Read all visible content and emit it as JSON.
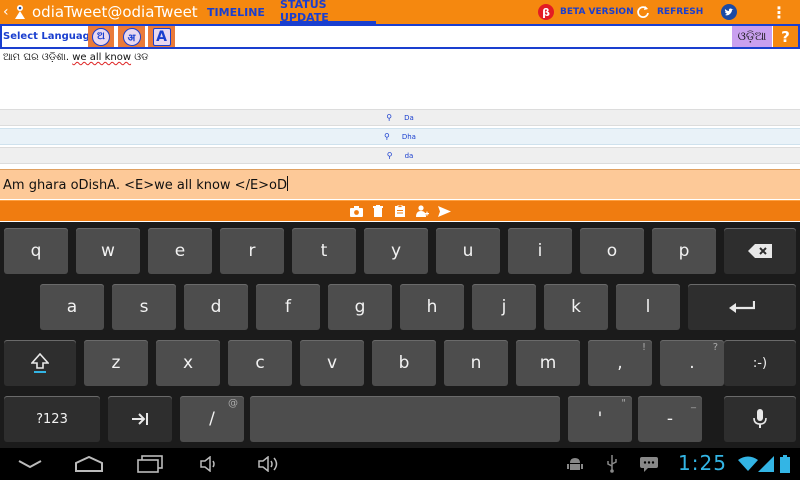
{
  "actionbar": {
    "title": "odiaTweet@odiaTweet",
    "tabs": [
      {
        "label": "TIMELINE",
        "selected": false
      },
      {
        "label": "STATUS UPDATE",
        "selected": true
      }
    ],
    "beta_icon": "β",
    "beta_label": "BETA VERSION",
    "refresh_label": "REFRESH",
    "accent": "#f5880f",
    "tab_color": "#1a3fcf"
  },
  "language": {
    "label": "Select Language",
    "buttons": [
      "ଅ",
      "अ",
      "A"
    ],
    "script_label": "ଓଡ଼ିଆ",
    "help_label": "?"
  },
  "preview": {
    "odia": "ଆମ ଘର ଓଡ଼ିଶା.",
    "english": "we all know",
    "tail": "ଓଡ"
  },
  "suggestions": [
    {
      "text": "Da",
      "highlight": false
    },
    {
      "text": "Dha",
      "highlight": true
    },
    {
      "text": "da",
      "highlight": false
    }
  ],
  "input": {
    "value": "Am ghara oDishA. <E>we all know </E>oD",
    "background": "#fdc998"
  },
  "toolbar": {
    "icons": [
      "camera-icon",
      "trash-icon",
      "clipboard-icon",
      "add-user-icon",
      "send-icon"
    ]
  },
  "keyboard": {
    "row1": [
      "q",
      "w",
      "e",
      "r",
      "t",
      "y",
      "u",
      "i",
      "o",
      "p"
    ],
    "row2": [
      "a",
      "s",
      "d",
      "f",
      "g",
      "h",
      "j",
      "k",
      "l"
    ],
    "row3": [
      "z",
      "x",
      "c",
      "v",
      "b",
      "n",
      "m",
      "!",
      "?"
    ],
    "row3_main": [
      "z",
      "x",
      "c",
      "v",
      "b",
      "n",
      "m",
      ",",
      "."
    ],
    "smiley": ":-)",
    "symbols": "?123",
    "slash": "/",
    "slash_hint": "@",
    "apostrophe": "'",
    "apostrophe_hint": "\"",
    "dash": "-",
    "dash_hint": "_"
  },
  "statusbar": {
    "time": "1:25",
    "clock_color": "#33b5e5"
  }
}
